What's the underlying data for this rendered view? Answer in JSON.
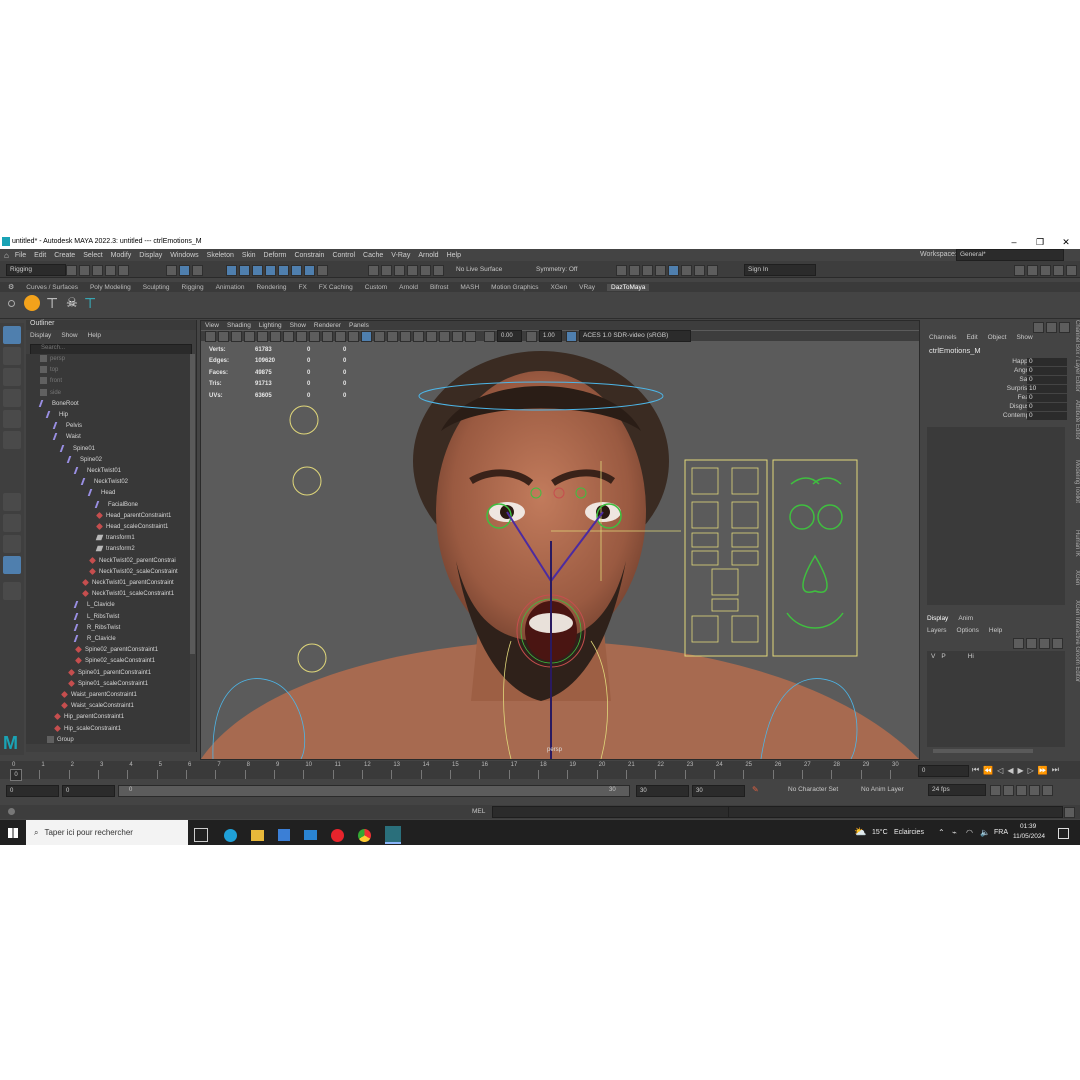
{
  "window": {
    "title": "untitled* - Autodesk MAYA 2022.3: untitled   ---   ctrlEmotions_M",
    "minimize": "–",
    "maximize": "❐",
    "close": "✕"
  },
  "menubar": {
    "items": [
      "File",
      "Edit",
      "Create",
      "Select",
      "Modify",
      "Display",
      "Windows",
      "Skeleton",
      "Skin",
      "Deform",
      "Constrain",
      "Control",
      "Cache",
      "V-Ray",
      "Arnold",
      "Help"
    ],
    "workspace_label": "Workspace:",
    "workspace_value": "General*"
  },
  "statusline": {
    "menuset": "Rigging",
    "live_surface": "No Live Surface",
    "symmetry": "Symmetry: Off",
    "sign_in": "Sign In"
  },
  "shelf": {
    "tabs": [
      "Curves / Surfaces",
      "Poly Modeling",
      "Sculpting",
      "Rigging",
      "Animation",
      "Rendering",
      "FX",
      "FX Caching",
      "Custom",
      "Arnold",
      "Bifrost",
      "MASH",
      "Motion Graphics",
      "XGen",
      "VRay",
      "DazToMaya"
    ],
    "active_tab": "DazToMaya"
  },
  "outliner": {
    "title": "Outliner",
    "menu": [
      "Display",
      "Show",
      "Help"
    ],
    "search_placeholder": "Search...",
    "items": [
      {
        "label": "persp",
        "depth": 0,
        "icon": "camera-icon",
        "dim": true
      },
      {
        "label": "top",
        "depth": 0,
        "icon": "camera-icon",
        "dim": true
      },
      {
        "label": "front",
        "depth": 0,
        "icon": "camera-icon",
        "dim": true
      },
      {
        "label": "side",
        "depth": 0,
        "icon": "camera-icon",
        "dim": true
      },
      {
        "label": "BoneRoot",
        "depth": 0,
        "icon": "joint-icon"
      },
      {
        "label": "Hip",
        "depth": 1,
        "icon": "joint-icon"
      },
      {
        "label": "Pelvis",
        "depth": 2,
        "icon": "joint-icon"
      },
      {
        "label": "Waist",
        "depth": 2,
        "icon": "joint-icon"
      },
      {
        "label": "Spine01",
        "depth": 3,
        "icon": "joint-icon"
      },
      {
        "label": "Spine02",
        "depth": 4,
        "icon": "joint-icon"
      },
      {
        "label": "NeckTwist01",
        "depth": 5,
        "icon": "joint-icon"
      },
      {
        "label": "NeckTwist02",
        "depth": 6,
        "icon": "joint-icon"
      },
      {
        "label": "Head",
        "depth": 7,
        "icon": "joint-icon"
      },
      {
        "label": "FacialBone",
        "depth": 8,
        "icon": "joint-icon"
      },
      {
        "label": "Head_parentConstraint1",
        "depth": 8,
        "icon": "constraint-icon"
      },
      {
        "label": "Head_scaleConstraint1",
        "depth": 8,
        "icon": "constraint-icon"
      },
      {
        "label": "transform1",
        "depth": 8,
        "icon": "transform-icon"
      },
      {
        "label": "transform2",
        "depth": 8,
        "icon": "transform-icon"
      },
      {
        "label": "NeckTwist02_parentConstrai",
        "depth": 7,
        "icon": "constraint-icon"
      },
      {
        "label": "NeckTwist02_scaleConstraint",
        "depth": 7,
        "icon": "constraint-icon"
      },
      {
        "label": "NeckTwist01_parentConstraint",
        "depth": 6,
        "icon": "constraint-icon"
      },
      {
        "label": "NeckTwist01_scaleConstraint1",
        "depth": 6,
        "icon": "constraint-icon"
      },
      {
        "label": "L_Clavicle",
        "depth": 5,
        "icon": "joint-icon"
      },
      {
        "label": "L_RibsTwist",
        "depth": 5,
        "icon": "joint-icon"
      },
      {
        "label": "R_RibsTwist",
        "depth": 5,
        "icon": "joint-icon"
      },
      {
        "label": "R_Clavicle",
        "depth": 5,
        "icon": "joint-icon"
      },
      {
        "label": "Spine02_parentConstraint1",
        "depth": 5,
        "icon": "constraint-icon"
      },
      {
        "label": "Spine02_scaleConstraint1",
        "depth": 5,
        "icon": "constraint-icon"
      },
      {
        "label": "Spine01_parentConstraint1",
        "depth": 4,
        "icon": "constraint-icon"
      },
      {
        "label": "Spine01_scaleConstraint1",
        "depth": 4,
        "icon": "constraint-icon"
      },
      {
        "label": "Waist_parentConstraint1",
        "depth": 3,
        "icon": "constraint-icon"
      },
      {
        "label": "Waist_scaleConstraint1",
        "depth": 3,
        "icon": "constraint-icon"
      },
      {
        "label": "Hip_parentConstraint1",
        "depth": 2,
        "icon": "constraint-icon"
      },
      {
        "label": "Hip_scaleConstraint1",
        "depth": 2,
        "icon": "constraint-icon"
      },
      {
        "label": "Group",
        "depth": 1,
        "icon": "group-icon"
      }
    ]
  },
  "viewport": {
    "menu": [
      "View",
      "Shading",
      "Lighting",
      "Show",
      "Renderer",
      "Panels"
    ],
    "exposure": "0.00",
    "gamma": "1.00",
    "color_space": "ACES 1.0 SDR-video (sRGB)",
    "camera_label": "persp",
    "hud": [
      {
        "label": "Verts:",
        "v1": "61783",
        "v2": "0",
        "v3": "0"
      },
      {
        "label": "Edges:",
        "v1": "109620",
        "v2": "0",
        "v3": "0"
      },
      {
        "label": "Faces:",
        "v1": "49875",
        "v2": "0",
        "v3": "0"
      },
      {
        "label": "Tris:",
        "v1": "91713",
        "v2": "0",
        "v3": "0"
      },
      {
        "label": "UVs:",
        "v1": "63605",
        "v2": "0",
        "v3": "0"
      }
    ]
  },
  "channelbox": {
    "menu": [
      "Channels",
      "Edit",
      "Object",
      "Show"
    ],
    "object_name": "ctrlEmotions_M",
    "attributes": [
      {
        "name": "Happy",
        "value": "0"
      },
      {
        "name": "Angry",
        "value": "0"
      },
      {
        "name": "Sad",
        "value": "0"
      },
      {
        "name": "Surprise",
        "value": "10"
      },
      {
        "name": "Fear",
        "value": "0"
      },
      {
        "name": "Disgust",
        "value": "0"
      },
      {
        "name": "Contempt",
        "value": "0"
      }
    ]
  },
  "side_tabs": [
    "Channel Box / Layer Editor",
    "Attribute Editor",
    "Modeling Toolkit",
    "Human IK",
    "XGen",
    "XGen Interactive Groom Editor"
  ],
  "layer_editor": {
    "tabs": [
      "Display",
      "Anim"
    ],
    "menu": [
      "Layers",
      "Options",
      "Help"
    ],
    "layer": {
      "v": "V",
      "p": "P",
      "name": "Hi"
    }
  },
  "timeline": {
    "ticks": [
      "0",
      "1",
      "2",
      "3",
      "4",
      "5",
      "6",
      "7",
      "8",
      "9",
      "10",
      "11",
      "12",
      "13",
      "14",
      "15",
      "16",
      "17",
      "18",
      "19",
      "20",
      "21",
      "22",
      "23",
      "24",
      "25",
      "26",
      "27",
      "28",
      "29",
      "30"
    ],
    "current_frame": "0",
    "current_field": "0"
  },
  "range": {
    "start": "0",
    "inner_start": "0",
    "slider_start": "0",
    "slider_end": "30",
    "end": "30",
    "outer_end": "30",
    "character_set": "No Character Set",
    "anim_layer": "No Anim Layer",
    "fps": "24 fps"
  },
  "cmdline": {
    "lang": "MEL"
  },
  "taskbar": {
    "search_placeholder": "Taper ici pour rechercher",
    "weather_temp": "15°C",
    "weather_text": "Eclaircies",
    "lang": "FRA",
    "time": "01:39",
    "date": "11/05/2024"
  },
  "colors": {
    "maya_bg": "#444444",
    "viewport_bg": "#5b5b5b",
    "accent_blue": "#4f7fae",
    "joint_purple": "#9a8fe3",
    "constraint_red": "#c64e4e",
    "control_yellow": "#e0d77a",
    "control_green": "#3fbf3f"
  }
}
